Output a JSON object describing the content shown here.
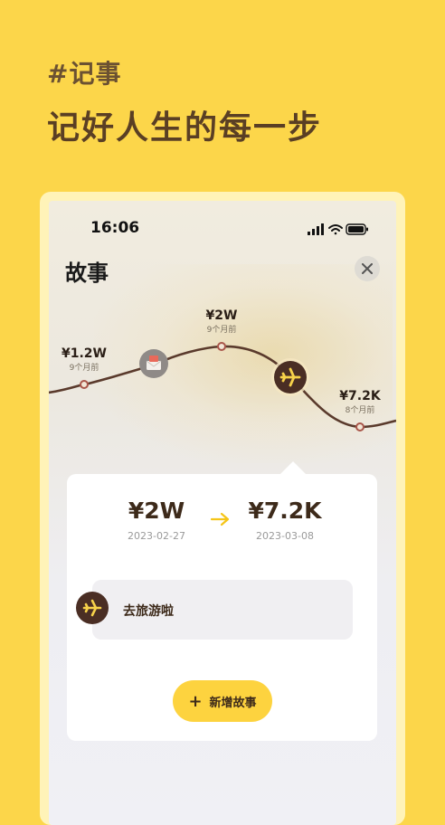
{
  "promo": {
    "tag": "#记事",
    "title": "记好人生的每一步"
  },
  "status_bar": {
    "time": "16:06"
  },
  "screen": {
    "title": "故事"
  },
  "timeline": {
    "points": [
      {
        "amount": "¥1.2W",
        "time_ago": "9个月前"
      },
      {
        "amount": "¥2W",
        "time_ago": "9个月前"
      },
      {
        "amount": "¥7.2K",
        "time_ago": "8个月前"
      }
    ],
    "event_icons": [
      "mail-icon",
      "airplane-icon"
    ]
  },
  "detail_card": {
    "from_amount": "¥2W",
    "from_date": "2023-02-27",
    "to_amount": "¥7.2K",
    "to_date": "2023-03-08",
    "story_label": "去旅游啦",
    "add_button_label": "新增故事"
  },
  "colors": {
    "background": "#FCD64A",
    "brown": "#4A2E24",
    "accent_yellow": "#FDD33F",
    "arrow_yellow": "#F5C518"
  }
}
